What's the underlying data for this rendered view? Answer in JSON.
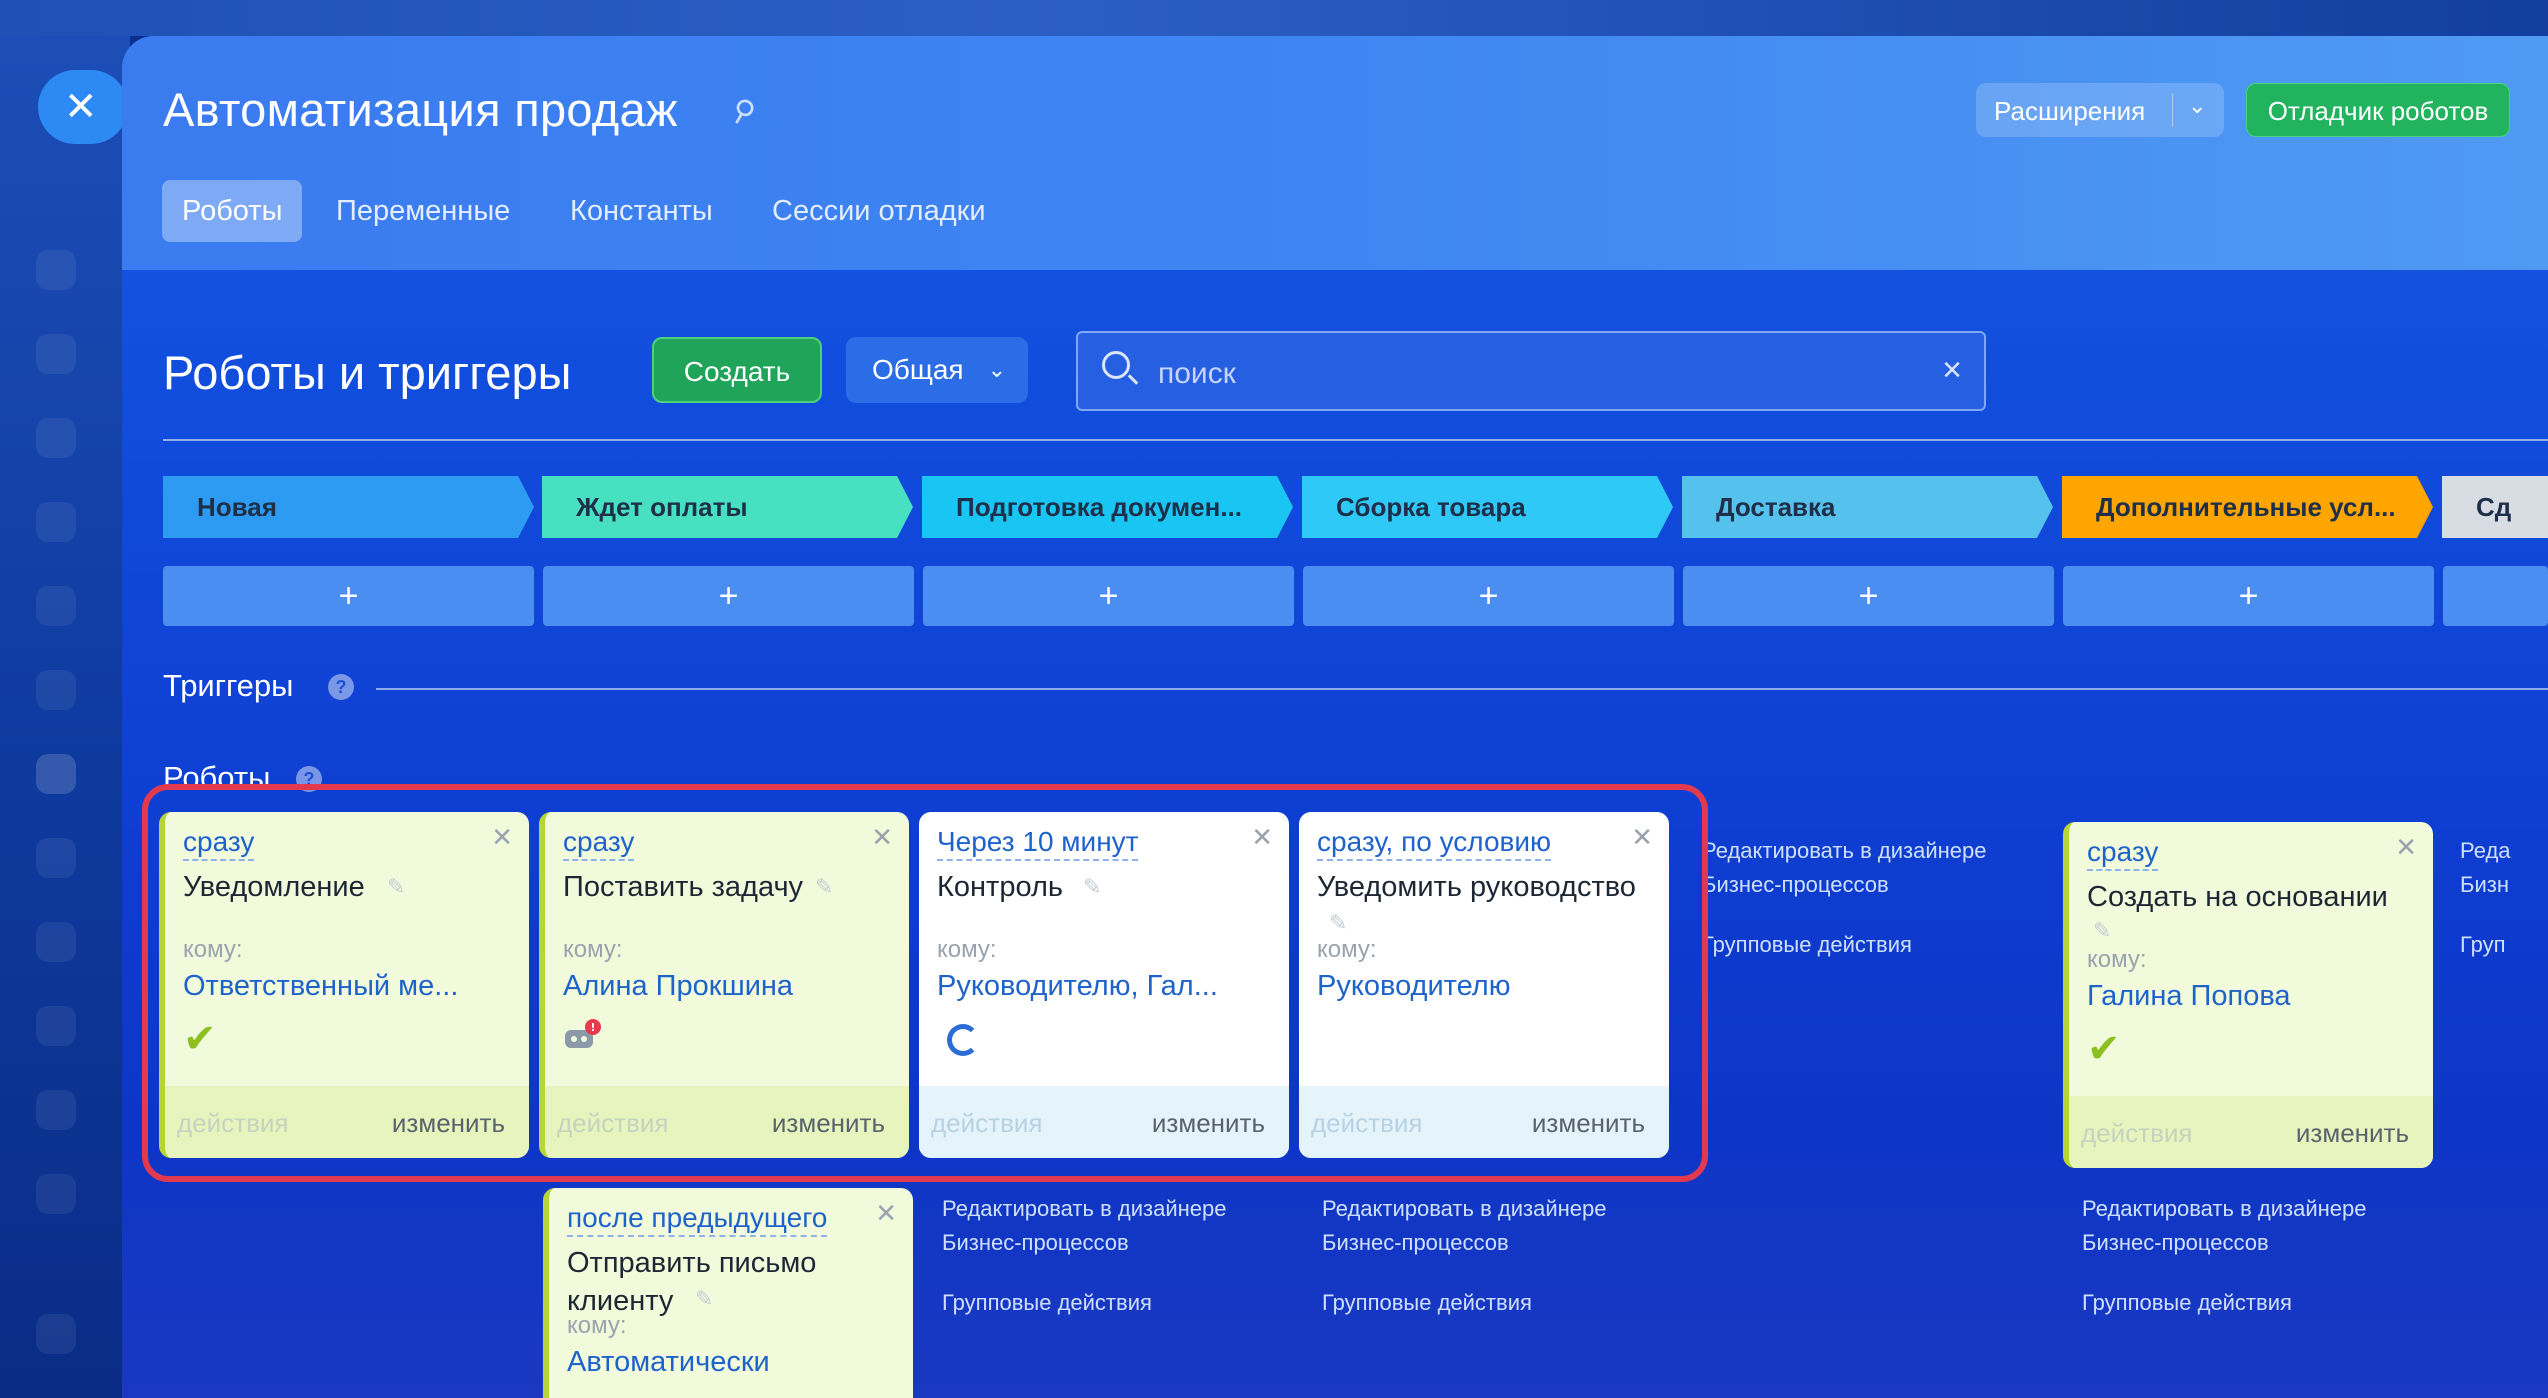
{
  "header": {
    "title": "Автоматизация продаж",
    "extensions_label": "Расширения",
    "debugger_label": "Отладчик роботов",
    "close_glyph": "✕"
  },
  "tabs": [
    {
      "label": "Роботы",
      "active": true
    },
    {
      "label": "Переменные"
    },
    {
      "label": "Константы"
    },
    {
      "label": "Сессии отладки"
    }
  ],
  "toolbar": {
    "title": "Роботы и триггеры",
    "create_label": "Создать",
    "filter_label": "Общая",
    "search_placeholder": "поиск"
  },
  "stages": [
    {
      "label": "Новая",
      "color": "#2d9bf2"
    },
    {
      "label": "Ждет оплаты",
      "color": "#47e0c1"
    },
    {
      "label": "Подготовка докумен...",
      "color": "#19c6f3"
    },
    {
      "label": "Сборка товара",
      "color": "#2fc9f7"
    },
    {
      "label": "Доставка",
      "color": "#55c2ee"
    },
    {
      "label": "Дополнительные усл...",
      "color": "#ffa500"
    },
    {
      "label": "Сд",
      "color": "#d8dde3"
    }
  ],
  "plus_glyph": "+",
  "sections": {
    "triggers": "Триггеры",
    "robots": "Роботы",
    "help_glyph": "?"
  },
  "robots": [
    {
      "when": "сразу",
      "name": "Уведомление",
      "to_label": "кому:",
      "recipient": "Ответственный ме...",
      "status": "done",
      "actions": "действия",
      "edit": "изменить"
    },
    {
      "when": "сразу",
      "name": "Поставить задачу",
      "to_label": "кому:",
      "recipient": "Алина Прокшина",
      "status": "warning",
      "actions": "действия",
      "edit": "изменить"
    },
    {
      "when": "Через 10 минут",
      "name": "Контроль",
      "to_label": "кому:",
      "recipient": "Руководителю, Гал...",
      "status": "waiting",
      "actions": "действия",
      "edit": "изменить"
    },
    {
      "when": "сразу, по условию",
      "name": "Уведомить руководство",
      "to_label": "кому:",
      "recipient": "Руководителю",
      "status": "none",
      "actions": "действия",
      "edit": "изменить"
    },
    {
      "when": "сразу",
      "name": "Создать на основании",
      "to_label": "кому:",
      "recipient": "Галина Попова",
      "status": "done",
      "actions": "действия",
      "edit": "изменить"
    },
    {
      "when": "после предыдущего",
      "name": "Отправить письмо клиенту",
      "to_label": "кому:",
      "recipient": "Автоматически",
      "status": "none"
    }
  ],
  "column_links": {
    "edit_designer": "Редактировать в дизайнере Бизнес-процессов",
    "group_actions": "Групповые действия",
    "cut_edit": "Реда",
    "cut_biz": "Бизн",
    "cut_group": "Груп"
  },
  "icons": {
    "close": "close-icon",
    "pin": "pin-icon",
    "search": "search-icon",
    "clear": "clear-icon",
    "chevron": "chevron-down-icon",
    "pencil": "pencil-icon",
    "check": "check-icon",
    "robot": "robot-warning-icon",
    "spinner": "spinner-icon"
  },
  "colors": {
    "accent_green": "#1fa45a",
    "link_blue": "#1e62cc",
    "highlight_red": "#e3394e"
  }
}
